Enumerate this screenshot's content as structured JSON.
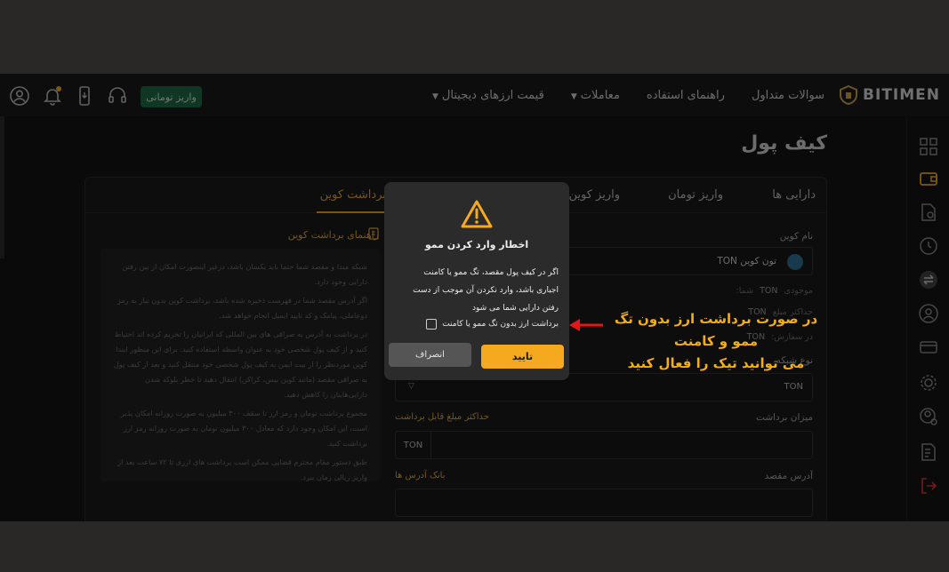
{
  "brand": {
    "name": "BITIMEN",
    "accent": "#f4a91f"
  },
  "nav": {
    "items": [
      "قیمت ارزهای دیجیتال",
      "معاملات",
      "راهنمای استفاده",
      "سوالات متداول"
    ],
    "deposit_label": "واریز تومانی"
  },
  "page": {
    "title": "کیف پول"
  },
  "tabs": [
    "دارایی ها",
    "واریز تومان",
    "واریز کوین",
    "برداشت کوین"
  ],
  "guide": {
    "title": "راهنمای برداشت کوین",
    "paragraphs": [
      "شبکه مبدا و مقصد شما حتما باید یکسان باشد، درغیر اینصورت امکان از بین رفتن دارایی وجود دارد.",
      "اگر آدرس مقصد شما در فهرست ذخیره شده باشد، برداشت کوین بدون نیاز به رمز دوعاملی، پیامک و کد تایید ایمیل انجام خواهد شد.",
      "در برداشت به آدرس به صرافی های بین المللی که ایرانیان را تحریم کرده اند احتیاط کنید و از کیف پول شخصی خود به عنوان واسطه استفاده کنید. برای این منظور ابتدا کوین موردنظر را از بیت ایمن به کیف پول شخصی خود منتقل کنید و بعد از کیف پول به صرافی مقصد (مانند کوین بیس، کراکن) انتقال دهید تا خطر بلوکه شدن دارایی‌هایتان را کاهش دهید.",
      "مجموع برداشت تومان و رمز ارز تا سقف ۳۰۰ میلیون به صورت روزانه امکان پذیر است، این امکان وجود دارد که معادل ۳۰۰ میلیون تومان به صورت روزانه رمز ارز برداشت کنید.",
      "طبق دستور مقام محترم قضایی ممکن است برداشت های ارزی تا ۷۲ ساعت بعد از واریز ریالی زمان ببرد."
    ]
  },
  "form": {
    "coin_label": "نام کوین",
    "coin_value": "تون کوین TON",
    "balance_label": "موجودی",
    "balance_value": "TON",
    "balance_suffix": "شما:",
    "max_label": "حداکثر مبلغ",
    "max_value": "TON",
    "order_label": "در سفارش:",
    "order_value": "TON",
    "network_label": "نوع شبکه",
    "network_value": "TON",
    "amount_label": "میزان برداشت",
    "max_link": "حداکثر مبلغ قابل برداشت",
    "amount_unit": "TON",
    "address_label": "آدرس مقصد",
    "address_book": "بانک آدرس ها"
  },
  "modal": {
    "title": "اخطار وارد کردن ممو",
    "body": "اگر در کیف پول مقصد، تگ ممو یا کامنت اجباری باشد، وارد نکردن آن موجب از دست رفتن دارایی شما می شود",
    "checkbox_label": "برداشت ارز بدون تگ ممو یا کامنت",
    "confirm_label": "تایید",
    "cancel_label": "انصراف"
  },
  "annotation": {
    "line1": "در صورت برداشت ارز بدون تگ ممو و کامنت",
    "line2": "می توانید تیک را فعال کنید",
    "color": "#f2ad1c"
  }
}
